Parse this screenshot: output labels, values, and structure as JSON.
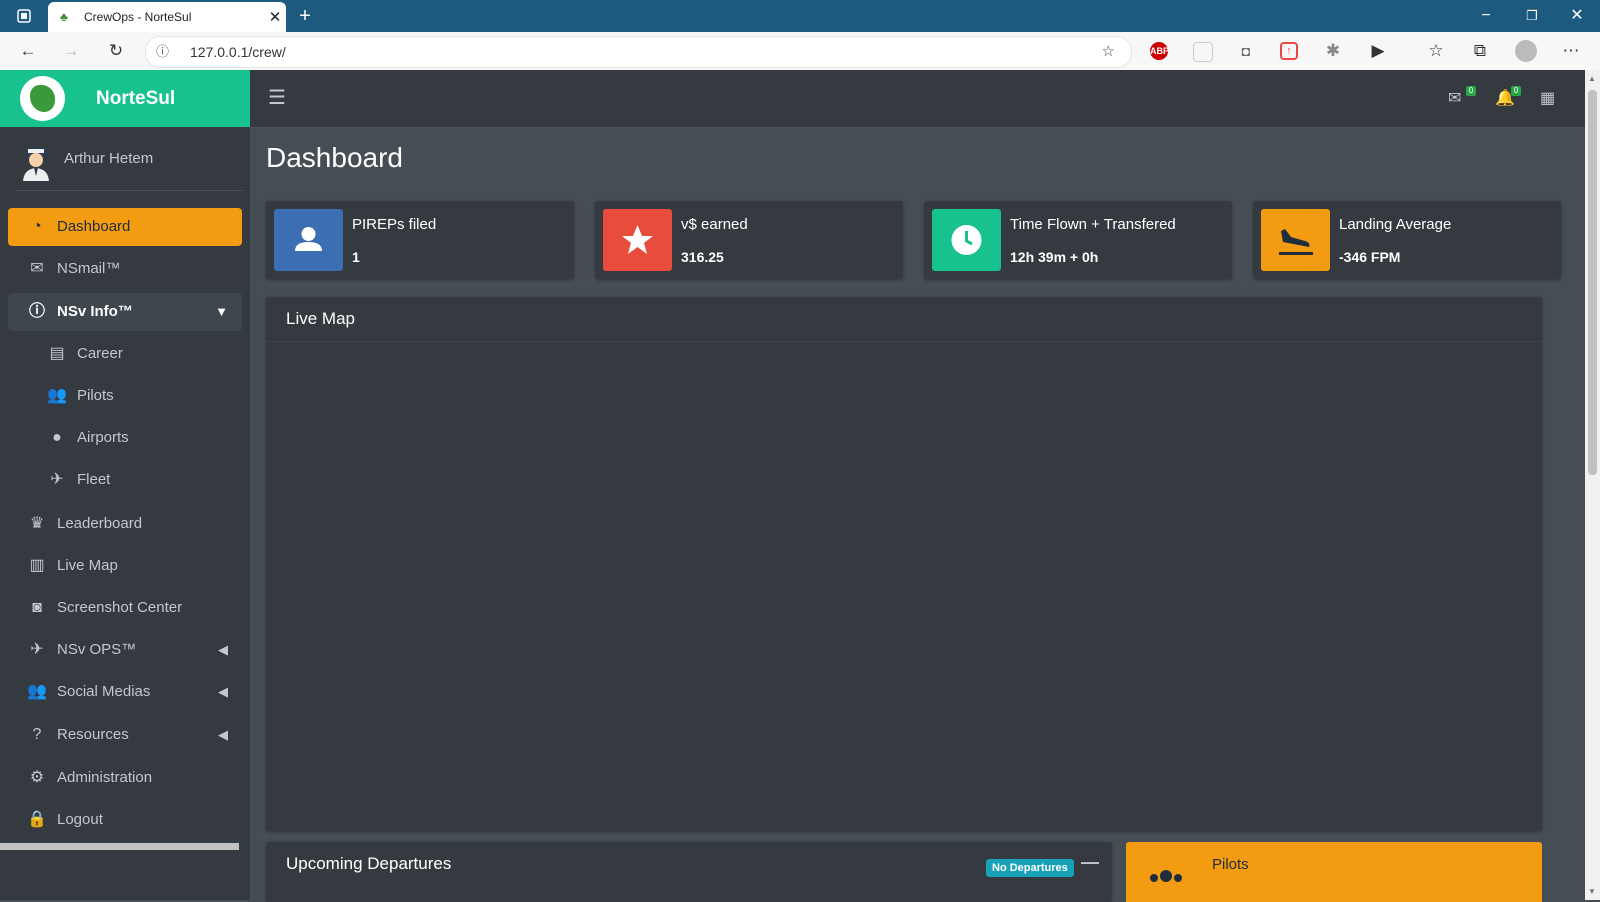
{
  "browser": {
    "tab_title": "CrewOps - NorteSul",
    "url": "127.0.0.1/crew/",
    "ext_abp": "ABP"
  },
  "brand": {
    "name": "NorteSul"
  },
  "user": {
    "name": "Arthur Hetem"
  },
  "sidebar": {
    "items": [
      {
        "label": "Dashboard",
        "icon": "tachometer-icon"
      },
      {
        "label": "NSmail™",
        "icon": "envelope-icon"
      },
      {
        "label": "NSv Info™",
        "icon": "info-circle-icon"
      },
      {
        "label": "Career",
        "icon": "id-card-icon"
      },
      {
        "label": "Pilots",
        "icon": "users-icon"
      },
      {
        "label": "Airports",
        "icon": "map-pin-icon"
      },
      {
        "label": "Fleet",
        "icon": "plane-icon"
      },
      {
        "label": "Leaderboard",
        "icon": "trophy-icon"
      },
      {
        "label": "Live Map",
        "icon": "map-icon"
      },
      {
        "label": "Screenshot Center",
        "icon": "camera-icon"
      },
      {
        "label": "NSv OPS™",
        "icon": "plane-departure-icon"
      },
      {
        "label": "Social Medias",
        "icon": "user-friends-icon"
      },
      {
        "label": "Resources",
        "icon": "question-circle-icon"
      },
      {
        "label": "Administration",
        "icon": "cog-icon"
      },
      {
        "label": "Logout",
        "icon": "lock-icon"
      }
    ]
  },
  "header": {
    "mail_badge": "0",
    "bell_badge": "0"
  },
  "page": {
    "title": "Dashboard"
  },
  "stats": [
    {
      "title": "PIREPs filed",
      "value": "1",
      "color": "#3c6eb4",
      "icon": "user-icon"
    },
    {
      "title": "v$ earned",
      "value": "316.25",
      "color": "#e74c3c",
      "icon": "star-icon"
    },
    {
      "title": "Time Flown + Transfered",
      "value": "12h 39m + 0h",
      "color": "#17c28e",
      "icon": "clock-icon"
    },
    {
      "title": "Landing Average",
      "value": "-346 FPM",
      "color": "#f39c12",
      "icon": "plane-arrival-icon"
    }
  ],
  "live_map": {
    "title": "Live Map"
  },
  "departures": {
    "title": "Upcoming Departures",
    "badge": "No Departures"
  },
  "pilots_box": {
    "title": "Pilots"
  }
}
